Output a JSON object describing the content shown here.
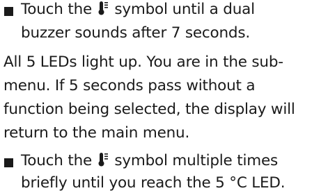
{
  "instructions": {
    "step1": {
      "bullet": "square-bullet",
      "text_before_icon": "Touch the",
      "icon": "thermometer-icon",
      "text_after_icon": "symbol until a dual",
      "line2": "buzzer sounds after 7 seconds."
    },
    "paragraph": {
      "line1": "All 5 LEDs light up. You are in the sub-",
      "line2": "menu. If 5 seconds pass without a",
      "line3": "function being selected, the display will",
      "line4": "return to the main menu."
    },
    "step2": {
      "bullet": "square-bullet",
      "text_before_icon": "Touch the",
      "icon": "thermometer-icon",
      "text_after_icon": "symbol multiple times",
      "line2": "briefly until you reach the 5 °C LED."
    }
  },
  "colors": {
    "text": "#1a1a1a",
    "background": "#ffffff"
  }
}
